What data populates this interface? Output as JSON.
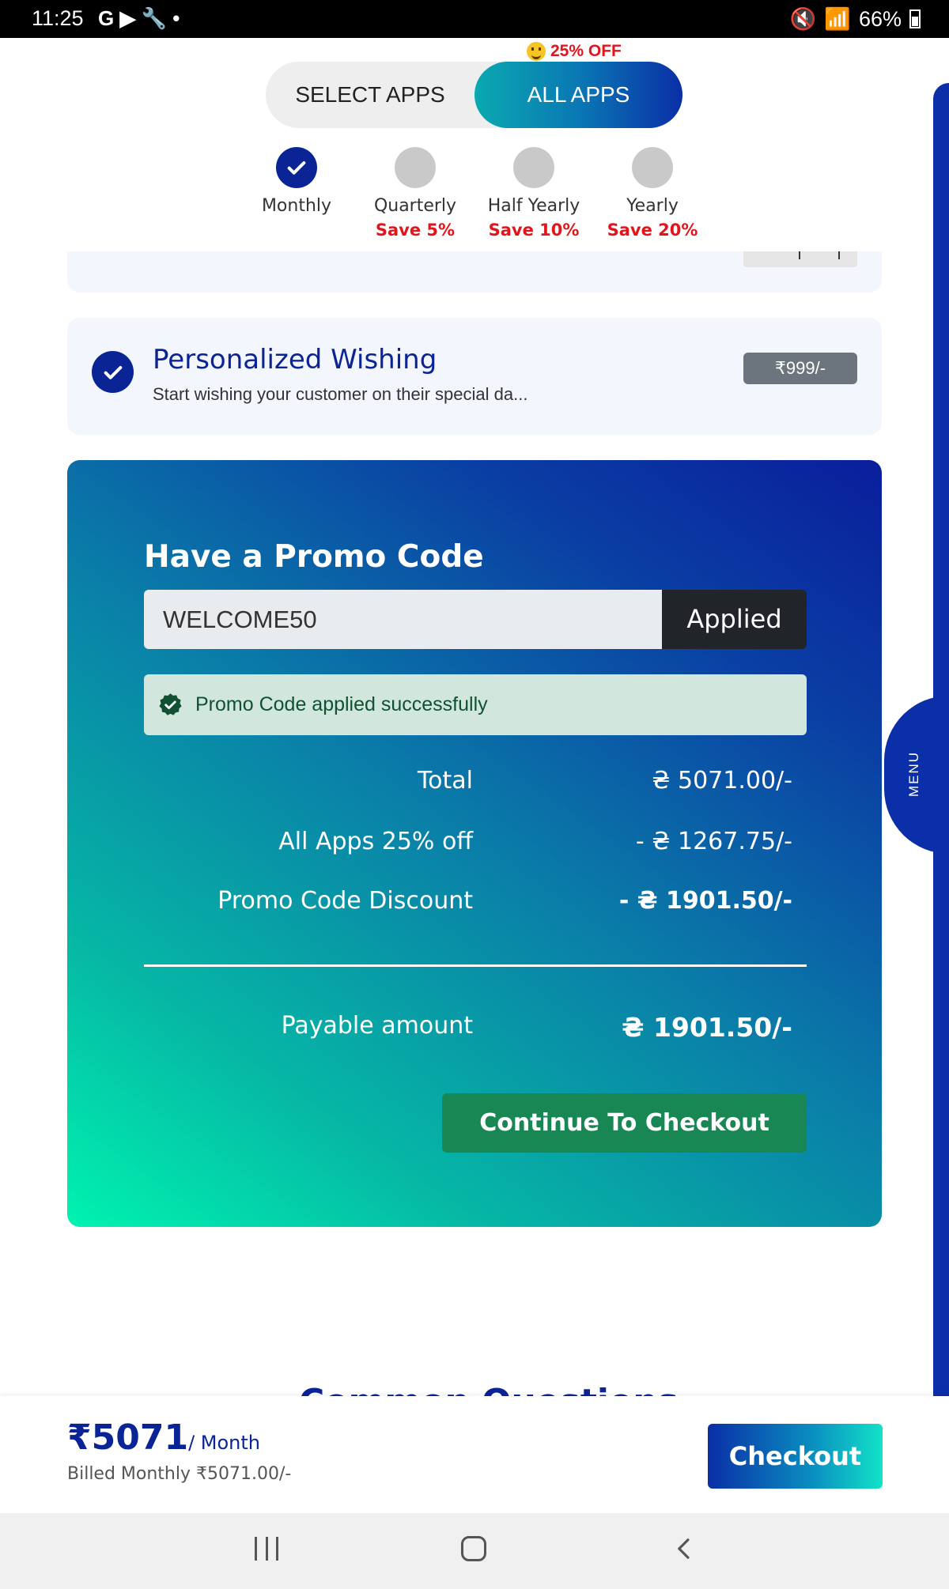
{
  "status_bar": {
    "time": "11:25",
    "left_icons": "G ▶ 🔧 •",
    "battery": "66%"
  },
  "plan_toggle": {
    "badge": "25% OFF",
    "select_apps": "SELECT APPS",
    "all_apps": "ALL APPS",
    "active": "ALL APPS"
  },
  "periods": [
    {
      "name": "Monthly",
      "save": "",
      "selected": true
    },
    {
      "name": "Quarterly",
      "save": "Save 5%",
      "selected": false
    },
    {
      "name": "Half Yearly",
      "save": "Save 10%",
      "selected": false
    },
    {
      "name": "Yearly",
      "save": "Save 20%",
      "selected": false
    }
  ],
  "app_card": {
    "title": "Personalized Wishing",
    "description": "Start wishing your customer on their special da...",
    "price": "₹999/-",
    "selected": true
  },
  "promo": {
    "heading": "Have a Promo Code",
    "code": "WELCOME50",
    "button": "Applied",
    "success_message": "Promo Code applied successfully"
  },
  "summary": {
    "total_label": "Total",
    "total_value": "₴ 5071.00/-",
    "discount_label": "All Apps 25% off",
    "discount_value": "- ₴ 1267.75/-",
    "promo_label": "Promo Code Discount",
    "promo_value": "- ₴ 1901.50/-",
    "payable_label": "Payable amount",
    "payable_value": "₴ 1901.50/-"
  },
  "continue_button": "Continue To Checkout",
  "common_questions": "Common Questions",
  "side_menu": "MENU",
  "bottom_bar": {
    "price": "₹5071",
    "unit": "/ Month",
    "billed": "Billed Monthly ₹5071.00/-",
    "checkout": "Checkout"
  },
  "colors": {
    "brand_blue": "#0a2496",
    "success_green": "#198754",
    "accent_red": "#e3141a"
  }
}
